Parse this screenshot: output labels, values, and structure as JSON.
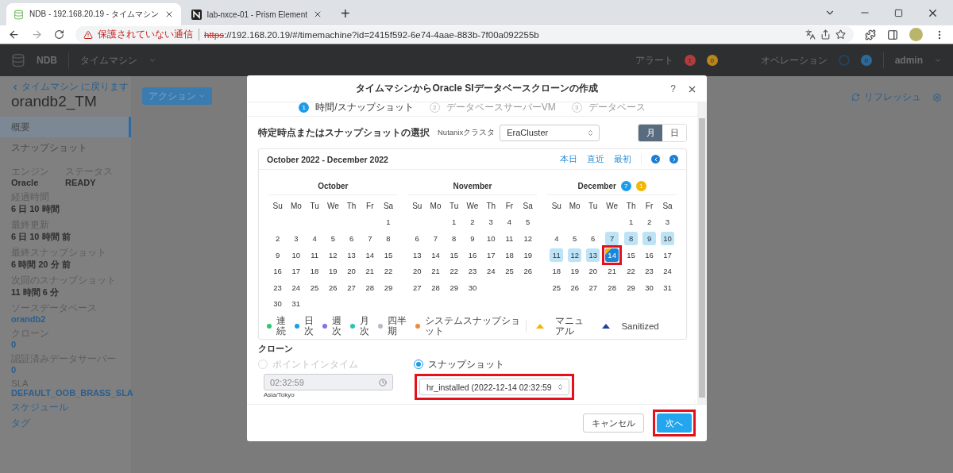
{
  "browser": {
    "tabs": [
      {
        "title": "NDB - 192.168.20.19 - タイムマシン",
        "selected": true,
        "kind": "ndb"
      },
      {
        "title": "lab-nxce-01 - Prism Element",
        "selected": false,
        "kind": "prism"
      }
    ],
    "new_tab": "+",
    "security_warning": "保護されていない通信",
    "url": {
      "scheme": "https",
      "rest": "://192.168.20.19/#/timemachine?id=2415f592-6e74-4aae-883b-7f00a092255b"
    }
  },
  "app_header": {
    "product": "NDB",
    "menu": "タイムマシン",
    "alerts_label": "アラート",
    "alert_counts": [
      {
        "count": "1",
        "color": "#b23b3b"
      },
      {
        "count": "0",
        "color": "#b8861b"
      }
    ],
    "operations_label": "オペレーション",
    "operation_count": "0",
    "user": "admin"
  },
  "sidebar": {
    "back_link": "タイムマシン に戻ります",
    "title": "orandb2_TM",
    "nav": [
      {
        "label": "概要",
        "selected": true
      },
      {
        "label": "スナップショット",
        "selected": false
      }
    ],
    "summary": [
      {
        "label": "エンジン",
        "value": "Oracle"
      },
      {
        "label": "ステータス",
        "value": "READY"
      }
    ],
    "fields": [
      {
        "label": "経過時間",
        "value": "6 日 10 時間",
        "kind": "text"
      },
      {
        "label": "最終更新",
        "value": "6 日 10 時間 前",
        "kind": "text"
      },
      {
        "label": "最終スナップショット",
        "value": "6 時間 20 分 前",
        "kind": "text"
      },
      {
        "label": "次回のスナップショット",
        "value": "11 時間 6 分",
        "kind": "text"
      },
      {
        "label": "ソースデータベース",
        "value": "orandb2",
        "kind": "link"
      },
      {
        "label": "クローン",
        "value": "0",
        "kind": "link"
      },
      {
        "label": "認証済みデータサーバー",
        "value": "0",
        "kind": "link"
      },
      {
        "label": "SLA",
        "value": "DEFAULT_OOB_BRASS_SLA",
        "kind": "link"
      }
    ],
    "links": [
      "スケジュール",
      "タグ"
    ]
  },
  "toolbar": {
    "action_button": "アクション",
    "refresh": "リフレッシュ"
  },
  "dialog": {
    "title": "タイムマシンからOracle SIデータベースクローンの作成",
    "help": "?",
    "steps": [
      {
        "number": "1",
        "label": "時間/スナップショット",
        "selected": true
      },
      {
        "number": "2",
        "label": "データベースサーバーVM",
        "selected": false
      },
      {
        "number": "3",
        "label": "データベース",
        "selected": false
      }
    ],
    "section_title": "特定時点またはスナップショットの選択",
    "cluster_label": "Nutanixクラスタ",
    "cluster_value": "EraCluster",
    "view_toggle": [
      {
        "label": "月",
        "selected": true
      },
      {
        "label": "日",
        "selected": false
      }
    ],
    "calendar": {
      "range": "October 2022 - December 2022",
      "links": [
        "本日",
        "直近",
        "最初"
      ],
      "months": [
        {
          "name": "October",
          "weekdays": [
            "Su",
            "Mo",
            "Tu",
            "We",
            "Th",
            "Fr",
            "Sa"
          ],
          "weeks": [
            [
              "1"
            ],
            [
              "2",
              "3",
              "4",
              "5",
              "6",
              "7",
              "8"
            ],
            [
              "9",
              "10",
              "11",
              "12",
              "13",
              "14",
              "15"
            ],
            [
              "16",
              "17",
              "18",
              "19",
              "20",
              "21",
              "22"
            ],
            [
              "23",
              "24",
              "25",
              "26",
              "27",
              "28",
              "29"
            ],
            [
              "30",
              "31"
            ]
          ]
        },
        {
          "name": "November",
          "weekdays": [
            "Su",
            "Mo",
            "Tu",
            "We",
            "Th",
            "Fr",
            "Sa"
          ],
          "weeks": [
            [
              "1",
              "2",
              "3",
              "4",
              "5"
            ],
            [
              "6",
              "7",
              "8",
              "9",
              "10",
              "11",
              "12"
            ],
            [
              "13",
              "14",
              "15",
              "16",
              "17",
              "18",
              "19"
            ],
            [
              "20",
              "21",
              "22",
              "23",
              "24",
              "25",
              "26"
            ],
            [
              "27",
              "28",
              "29",
              "30"
            ]
          ]
        },
        {
          "name": "December",
          "badges": [
            {
              "count": "7",
              "color": "#1e9be8"
            },
            {
              "count": "1",
              "color": "#f5b500"
            }
          ],
          "weekdays": [
            "Su",
            "Mo",
            "Tu",
            "We",
            "Th",
            "Fr",
            "Sa"
          ],
          "weeks": [
            [
              "1",
              "2",
              "3"
            ],
            [
              "4",
              "5",
              "6",
              {
                "day": "7",
                "snapshot": true,
                "selected": false,
                "manual": false
              },
              {
                "day": "8",
                "snapshot": true,
                "selected": false,
                "manual": false
              },
              {
                "day": "9",
                "snapshot": true,
                "selected": false,
                "manual": false
              },
              {
                "day": "10",
                "snapshot": true,
                "selected": false,
                "manual": false
              }
            ],
            [
              {
                "day": "11",
                "snapshot": true,
                "selected": false,
                "manual": false
              },
              {
                "day": "12",
                "snapshot": true,
                "selected": false,
                "manual": false
              },
              {
                "day": "13",
                "snapshot": true,
                "selected": false,
                "manual": false
              },
              {
                "day": "14",
                "snapshot": true,
                "selected": true,
                "manual": true,
                "callout": true
              },
              "15",
              "16",
              "17"
            ],
            [
              "18",
              "19",
              "20",
              "21",
              "22",
              "23",
              "24"
            ],
            [
              "25",
              "26",
              "27",
              "28",
              "29",
              "30",
              "31"
            ]
          ]
        }
      ]
    },
    "legend": [
      {
        "label": "連続",
        "kind": "dot",
        "color": "#2dc76d"
      },
      {
        "label": "日次",
        "kind": "dot",
        "color": "#1e9be8"
      },
      {
        "label": "週次",
        "kind": "dot",
        "color": "#8a6de9"
      },
      {
        "label": "月次",
        "kind": "dot",
        "color": "#26c6b8"
      },
      {
        "label": "四半期",
        "kind": "dot",
        "color": "#b4bac6"
      },
      {
        "label": "システムスナップショット",
        "kind": "dot",
        "color": "#f5883a"
      },
      {
        "label": "マニュアル",
        "kind": "triangle",
        "color": "#f5b500"
      },
      {
        "label": "Sanitized",
        "kind": "triangle",
        "color": "#22409a"
      }
    ],
    "clone": {
      "title": "クローン",
      "options": [
        {
          "label": "ポイントインタイム",
          "selected": false,
          "disabled": true
        },
        {
          "label": "スナップショット",
          "selected": true,
          "disabled": false
        }
      ],
      "time_value": "02:32:59",
      "timezone": "Asia/Tokyo",
      "snapshot_value": "hr_installed (2022-12-14 02:32:59",
      "snapshot_callout": true
    },
    "buttons": [
      {
        "label": "キャンセル",
        "kind": "secondary",
        "callout": false
      },
      {
        "label": "次へ",
        "kind": "primary",
        "callout": true
      }
    ]
  }
}
